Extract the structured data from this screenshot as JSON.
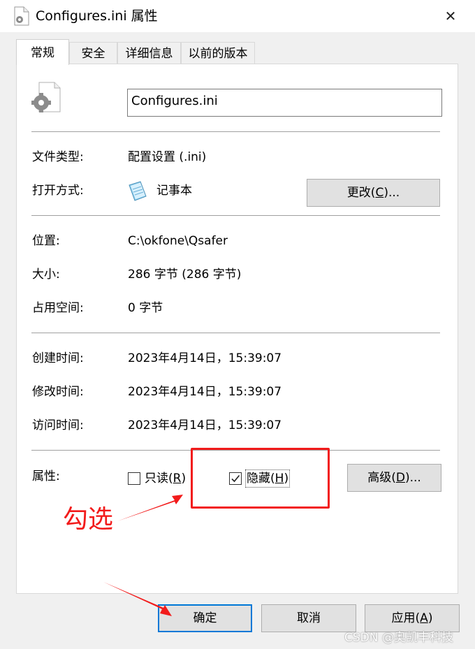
{
  "window": {
    "title": "Configures.ini 属性",
    "icon": "settings-file-icon",
    "close_glyph": "✕"
  },
  "tabs": [
    {
      "label": "常规",
      "active": true
    },
    {
      "label": "安全",
      "active": false
    },
    {
      "label": "详细信息",
      "active": false
    },
    {
      "label": "以前的版本",
      "active": false
    }
  ],
  "general": {
    "filename": "Configures.ini",
    "file_type_label": "文件类型:",
    "file_type_value": "配置设置 (.ini)",
    "open_with_label": "打开方式:",
    "open_with_value": "记事本",
    "change_button": {
      "text": "更改(",
      "key": "C",
      "suffix": ")..."
    },
    "location_label": "位置:",
    "location_value": "C:\\okfone\\Qsafer",
    "size_label": "大小:",
    "size_value": "286 字节 (286 字节)",
    "disk_size_label": "占用空间:",
    "disk_size_value": "0 字节",
    "created_label": "创建时间:",
    "created_value": "2023年4月14日，15:39:07",
    "modified_label": "修改时间:",
    "modified_value": "2023年4月14日，15:39:07",
    "accessed_label": "访问时间:",
    "accessed_value": "2023年4月14日，15:39:07",
    "attributes_label": "属性:",
    "readonly": {
      "text": "只读(",
      "key": "R",
      "suffix": ")",
      "checked": false
    },
    "hidden": {
      "text": "隐藏(",
      "key": "H",
      "suffix": ")",
      "checked": true
    },
    "advanced_button": {
      "text": "高级(",
      "key": "D",
      "suffix": ")..."
    }
  },
  "annotation": {
    "text": "勾选",
    "color": "#f21b1b"
  },
  "footer": {
    "ok": "确定",
    "cancel": "取消",
    "apply": {
      "text": "应用(",
      "key": "A",
      "suffix": ")"
    }
  },
  "watermark": "CSDN @奥凯丰科技",
  "colors": {
    "accent": "#0078d7",
    "annotation_red": "#f21b1b",
    "button_face": "#e1e1e1"
  }
}
